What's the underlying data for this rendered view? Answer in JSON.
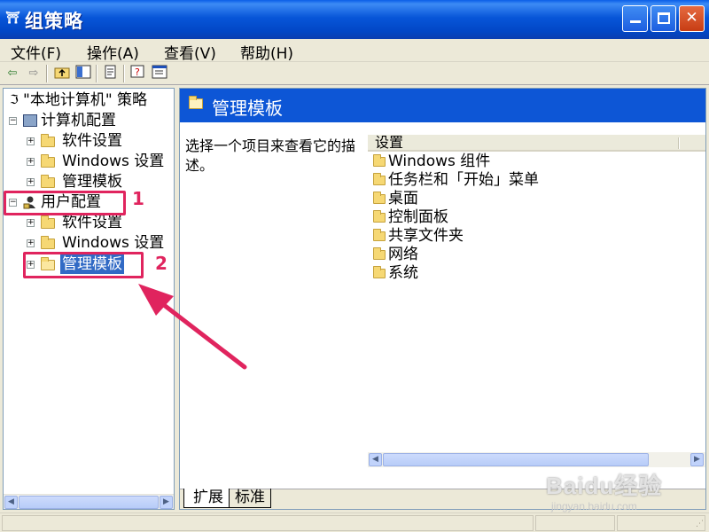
{
  "window": {
    "title": "组策略",
    "app_icon_glyph": "⛩",
    "close_glyph": "✕"
  },
  "menu": [
    {
      "label": "文件(F)"
    },
    {
      "label": "操作(A)"
    },
    {
      "label": "查看(V)"
    },
    {
      "label": "帮助(H)"
    }
  ],
  "toolbar": {
    "items": [
      "back-arrow-icon",
      "forward-arrow-icon",
      "up-folder-icon",
      "show-hide-tree-icon",
      "export-list-icon",
      "help-icon",
      "properties-icon"
    ]
  },
  "tree": {
    "root": "\"本地计算机\" 策略",
    "computer_config": "计算机配置",
    "computer_children": [
      "软件设置",
      "Windows 设置",
      "管理模板"
    ],
    "user_config": "用户配置",
    "user_children": [
      "软件设置",
      "Windows 设置",
      "管理模板"
    ]
  },
  "right_pane": {
    "header_title": "管理模板",
    "description": "选择一个项目来查看它的描述。",
    "column_header": "设置",
    "items": [
      "Windows 组件",
      "任务栏和「开始」菜单",
      "桌面",
      "控制面板",
      "共享文件夹",
      "网络",
      "系统"
    ]
  },
  "tabs": {
    "extended": "扩展",
    "standard": "标准"
  },
  "annotations": {
    "label_1": "1",
    "label_2": "2",
    "color": "#e0245e"
  },
  "watermark": {
    "brand": "Baidu经验",
    "url": "jingyan.baidu.com"
  },
  "colors": {
    "title_bar": "#0755d8",
    "header_band": "#0d56d6",
    "selection": "#316ac5",
    "chrome": "#ece9d8"
  }
}
